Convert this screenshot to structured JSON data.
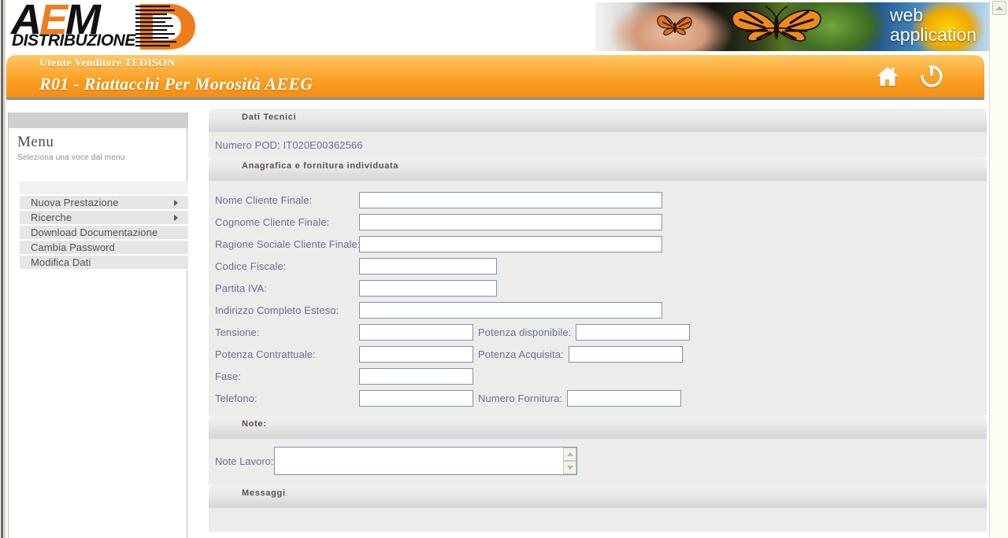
{
  "banner": {
    "logo_main_left": "A",
    "logo_main_mid": "E",
    "logo_main_right": "M",
    "logo_sub": "DISTRIBUZIONE",
    "photo_text_line1": "web",
    "photo_text_line2": "application"
  },
  "title_bar": {
    "user_line": "Utente Venditore TEDISON",
    "page_title": "R01 - Riattacchi Per Morosità AEEG",
    "home_icon": "home-icon",
    "power_icon": "power-icon"
  },
  "sidebar": {
    "heading": "Menu",
    "subtitle": "Seleziona una voce dal menu",
    "items": [
      {
        "label": "Nuova Prestazione",
        "has_submenu": true
      },
      {
        "label": "Ricerche",
        "has_submenu": true
      },
      {
        "label": "Download Documentazione",
        "has_submenu": false
      },
      {
        "label": "Cambia Password",
        "has_submenu": false
      },
      {
        "label": "Modifica Dati",
        "has_submenu": false
      }
    ]
  },
  "main": {
    "section_dati_tecnici": {
      "header": "Dati Tecnici",
      "pod_line": "Numero POD: IT020E00362566"
    },
    "section_anagrafica": {
      "header": "Anagrafica e fornitura individuata",
      "fields": {
        "nome": {
          "label": "Nome Cliente Finale:",
          "value": ""
        },
        "cognome": {
          "label": "Cognome Cliente Finale:",
          "value": ""
        },
        "ragione_sociale": {
          "label": "Ragione Sociale Cliente Finale:",
          "value": ""
        },
        "codice_fiscale": {
          "label": "Codice Fiscale:",
          "value": ""
        },
        "partita_iva": {
          "label": "Partita IVA:",
          "value": ""
        },
        "indirizzo": {
          "label": "Indirizzo Completo Esteso:",
          "value": ""
        },
        "tensione": {
          "label": "Tensione:",
          "value": ""
        },
        "potenza_disponibile": {
          "label": "Potenza disponibile:",
          "value": ""
        },
        "potenza_contrattuale": {
          "label": "Potenza Contrattuale:",
          "value": ""
        },
        "potenza_acquisita": {
          "label": "Potenza Acquisita:",
          "value": ""
        },
        "fase": {
          "label": "Fase:",
          "value": ""
        },
        "telefono": {
          "label": "Telefono:",
          "value": ""
        },
        "numero_fornitura": {
          "label": "Numero Fornitura:",
          "value": ""
        }
      }
    },
    "section_note": {
      "header": "Note:",
      "note_lavoro_label": "Note Lavoro:",
      "note_lavoro_value": ""
    },
    "section_messaggi": {
      "header": "Messaggi"
    }
  },
  "colors": {
    "accent_orange": "#f99f20",
    "logo_orange": "#f07c1e",
    "label_blue": "#6b6f96",
    "input_border": "#7b94b4",
    "section_header_text": "#5a5048",
    "content_bg": "#ececea"
  }
}
